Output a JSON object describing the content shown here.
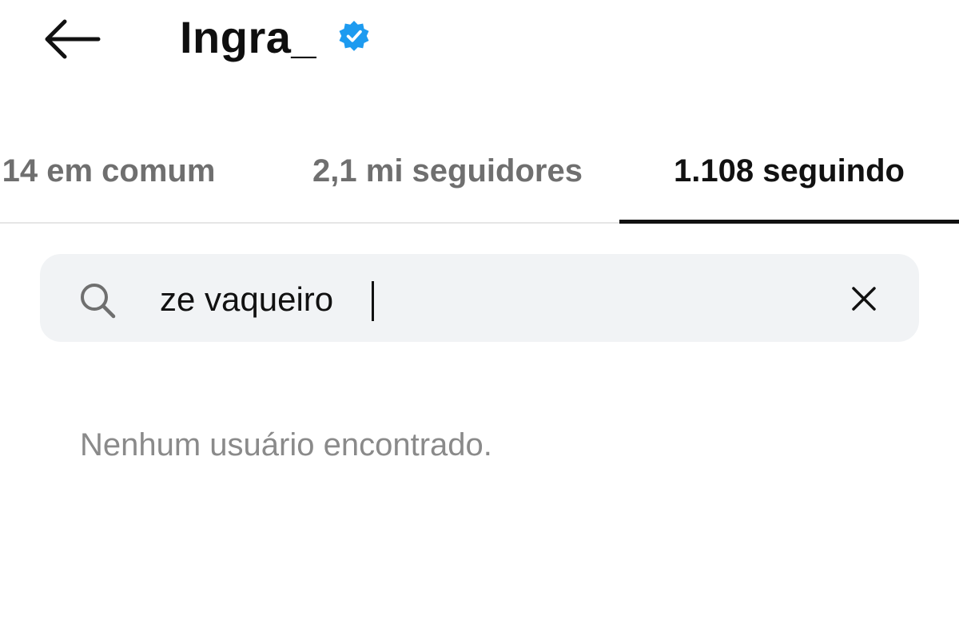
{
  "header": {
    "username": "Ingra_",
    "back_icon": "arrow-left-icon",
    "verified_icon": "verified-badge-icon",
    "verified_color": "#1d9bf0"
  },
  "tabs": [
    {
      "label": "14 em comum",
      "active": false
    },
    {
      "label": "2,1 mi seguidores",
      "active": false
    },
    {
      "label": "1.108 seguindo",
      "active": true
    }
  ],
  "search": {
    "value": "ze vaqueiro",
    "placeholder": "",
    "search_icon": "search-icon",
    "clear_icon": "close-icon"
  },
  "results": {
    "empty_message": "Nenhum usuário encontrado."
  },
  "colors": {
    "text_primary": "#111111",
    "text_secondary": "#6f6f6f",
    "search_background": "#f1f3f5",
    "divider": "#e6e6e6"
  }
}
